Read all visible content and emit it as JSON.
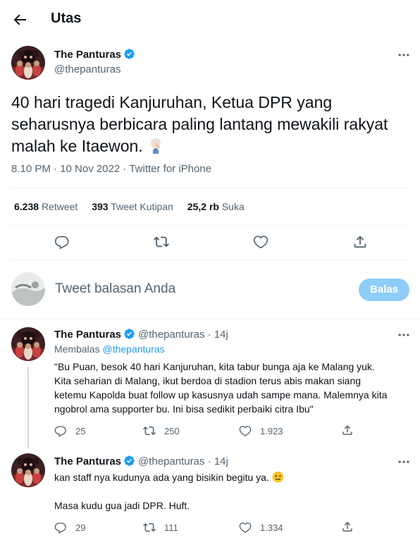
{
  "header": {
    "title": "Utas"
  },
  "main_tweet": {
    "author_name": "The Panturas",
    "author_handle": "@thepanturas",
    "text_line1": "40 hari tragedi Kanjuruhan, Ketua DPR yang",
    "text_line2": "seharusnya berbicara paling lantang mewakili rakyat",
    "text_line3": "malah ke Itaewon.",
    "meta": "8.10 PM · 10 Nov 2022 · Twitter for iPhone",
    "stats": {
      "retweets_value": "6.238",
      "retweets_label": "Retweet",
      "quotes_value": "393",
      "quotes_label": "Tweet Kutipan",
      "likes_value": "25,2 rb",
      "likes_label": "Suka"
    }
  },
  "compose": {
    "placeholder": "Tweet balasan Anda",
    "button": "Balas"
  },
  "replies": [
    {
      "author_name": "The Panturas",
      "meta": "@thepanturas · 14j",
      "replying_label": "Membalas",
      "replying_to": "@thepanturas",
      "line1": "\"Bu Puan, besok 40 hari Kanjuruhan, kita tabur bunga aja ke Malang yuk.",
      "line2": "Kita seharian di Malang, ikut berdoa di stadion terus abis makan siang",
      "line3": "ketemu Kapolda buat follow up kasusnya udah sampe mana. Malemnya kita",
      "line4": "ngobrol ama supporter bu. Ini bisa sedikit perbaiki citra Ibu\"",
      "replies_count": "25",
      "retweets_count": "250",
      "likes_count": "1.923"
    },
    {
      "author_name": "The Panturas",
      "meta": "@thepanturas · 14j",
      "line1": "kan staff nya kudunya ada yang bisikin begitu ya.",
      "line2": "Masa kudu gua jadi DPR. Huft.",
      "replies_count": "29",
      "retweets_count": "111",
      "likes_count": "1.334"
    }
  ],
  "colors": {
    "accent": "#1d9bf0",
    "secondary_text": "#536471",
    "disabled_button": "#8ecdf8",
    "divider": "#eff3f4"
  }
}
